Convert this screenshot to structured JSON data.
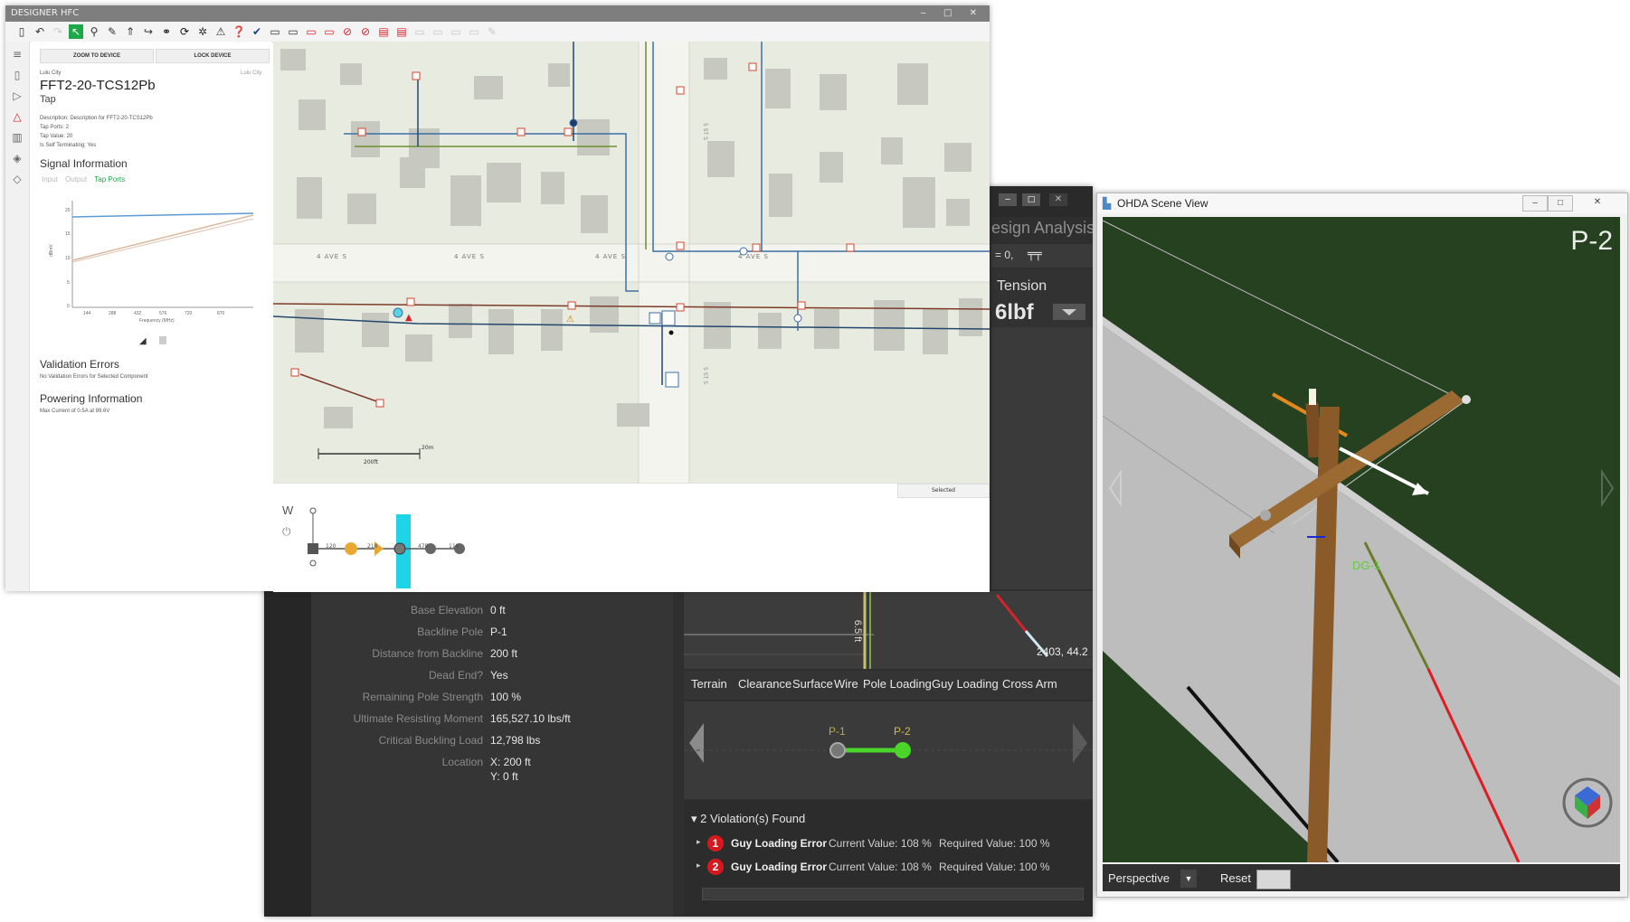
{
  "designer": {
    "title": "DESIGNER HFC",
    "toolbar_icons": [
      "new-file-icon",
      "undo-icon",
      "redo-icon",
      "select-icon",
      "pin-icon",
      "pen-icon",
      "arrow-up-icon",
      "route-icon",
      "device-icon",
      "rotate-icon",
      "settings-icon",
      "pole-icon",
      "help-icon",
      "check-icon",
      "window-icon",
      "window-icon",
      "window-icon",
      "window-icon",
      "cancel-icon",
      "cancel-icon",
      "report-icon",
      "report-icon",
      "window-icon",
      "window-icon",
      "window-icon",
      "window-icon",
      "edit-icon"
    ],
    "panel": {
      "zoom_button": "ZOOM TO DEVICE",
      "lock_button": "LOCK DEVICE",
      "city_left": "Lulu City",
      "city_right": "Lulu City",
      "device_name": "FFT2-20-TCS12Pb",
      "device_type": "Tap",
      "description": "Description: Description for FFT2-20-TCS12Pb",
      "tap_ports": "Tap Ports: 2",
      "tap_value": "Tap Value: 20",
      "self_terminating": "Is Self Terminating: Yes",
      "signal_heading": "Signal Information",
      "signal_tabs": [
        "Input",
        "Output",
        "Tap Ports"
      ],
      "chart_y_label": "dBmV",
      "chart_x_label": "Frequency (MHz)",
      "validation_heading": "Validation Errors",
      "validation_text": "No Validation Errors for Selected Component",
      "powering_heading": "Powering Information",
      "powering_text": "Max Current of 0.5A at 89.6V"
    },
    "map": {
      "street_labels": [
        "4 AVE S",
        "4 AVE S",
        "4 AVE S",
        "4 AVE S"
      ],
      "scale_label": "20m",
      "scale_label2": "200ft",
      "selected_tab": "Selected"
    },
    "bottom": {
      "side_label": "W",
      "node_values": [
        "120",
        "218",
        "478",
        "118"
      ]
    }
  },
  "analysis": {
    "header": "esign Analysis",
    "tension_label": "Tension",
    "tension_value": "6lbf",
    "dropdown_fragment": "= 0,",
    "properties": [
      {
        "key": "Base Elevation",
        "value": "0 ft"
      },
      {
        "key": "Backline Pole",
        "value": "P-1"
      },
      {
        "key": "Distance from Backline",
        "value": "200 ft"
      },
      {
        "key": "Dead End?",
        "value": "Yes"
      },
      {
        "key": "Remaining Pole Strength",
        "value": "100 %"
      },
      {
        "key": "Ultimate Resisting Moment",
        "value": "165,527.10 lbs/ft"
      },
      {
        "key": "Critical Buckling Load",
        "value": "12,798 lbs"
      },
      {
        "key": "Location",
        "value": "X: 200 ft"
      }
    ],
    "location_y": "Y: 0 ft",
    "chart_label_vertical": "6.5 ft",
    "chart_coord": "2403, 44.2",
    "tabs": [
      "Terrain",
      "Clearance",
      "Surface",
      "Wire",
      "Pole Loading",
      "Guy Loading",
      "Cross Arm"
    ],
    "poles": [
      "P-1",
      "P-2"
    ],
    "violations_header": "2 Violation(s) Found",
    "violations": [
      {
        "index": "1",
        "title": "Guy Loading Error",
        "current": "Current Value: 108 %",
        "required": "Required Value: 100 %"
      },
      {
        "index": "2",
        "title": "Guy Loading Error",
        "current": "Current Value: 108 %",
        "required": "Required Value: 100 %"
      }
    ]
  },
  "scene": {
    "title": "OHDA Scene View",
    "pole_label": "P-2",
    "guy_label": "DG-1",
    "perspective": "Perspective",
    "reset": "Reset"
  },
  "colors": {
    "accent_green": "#1ea84a",
    "scene_green": "#25411f",
    "violation_red": "#d6191f",
    "highlight_cyan": "#1fd4e6",
    "analysis_bg": "#2f2f2f"
  }
}
